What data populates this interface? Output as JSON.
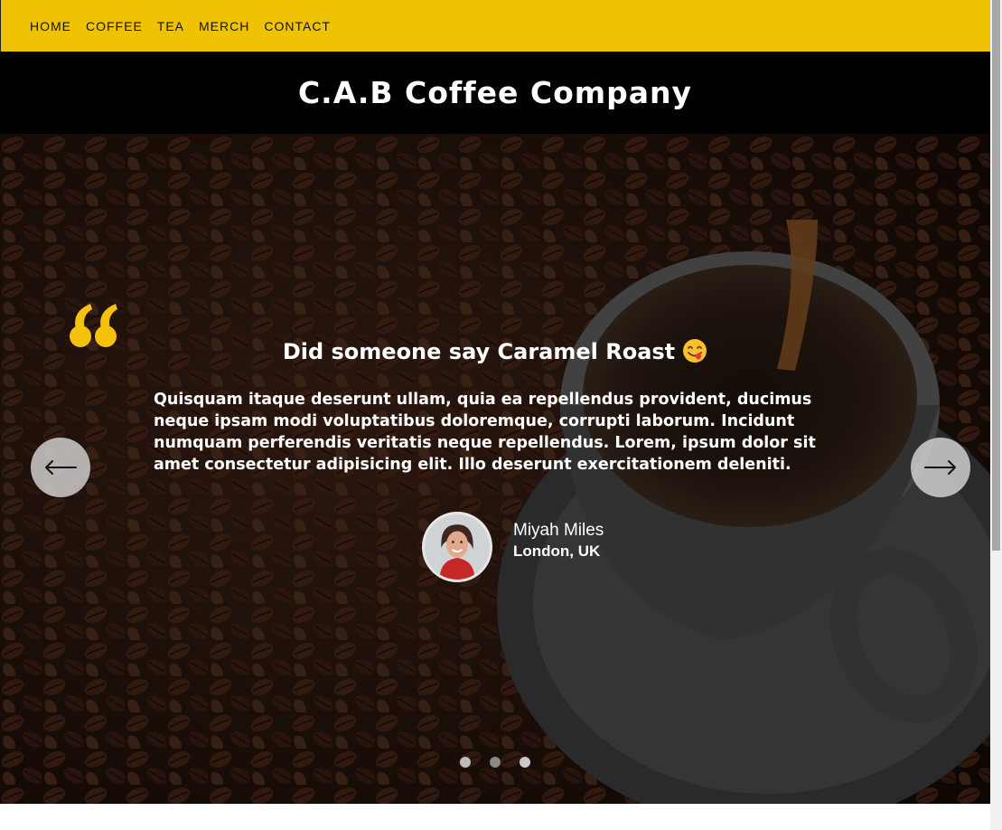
{
  "nav": {
    "items": [
      {
        "label": "HOME"
      },
      {
        "label": "COFFEE"
      },
      {
        "label": "TEA"
      },
      {
        "label": "MERCH"
      },
      {
        "label": "CONTACT"
      }
    ]
  },
  "header": {
    "title": "C.A.B Coffee Company"
  },
  "testimonial": {
    "title": "Did someone say Caramel Roast",
    "emoji_icon": "face-savoring-food-emoji",
    "quote_icon": "quote-mark-icon",
    "text": "Quisquam itaque deserunt ullam, quia ea repellendus provident, ducimus neque ipsam modi voluptatibus doloremque, corrupti laborum. Incidunt numquam perferendis veritatis neque repellendus. Lorem, ipsum dolor sit amet consectetur adipisicing elit. Illo deserunt exercitationem deleniti.",
    "author": {
      "name": "Miyah Miles",
      "location": "London, UK"
    }
  },
  "carousel": {
    "prev_icon": "arrow-left-icon",
    "next_icon": "arrow-right-icon",
    "slide_count": 3,
    "active_index": 0
  },
  "colors": {
    "nav_bg": "#efc304",
    "header_bg": "#000000",
    "accent": "#f3c20d",
    "text": "#ffffff"
  }
}
